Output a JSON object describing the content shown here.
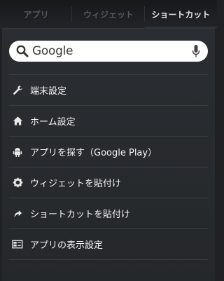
{
  "tabs": [
    {
      "label": "アプリ"
    },
    {
      "label": "ウィジェット"
    },
    {
      "label": "ショートカット"
    }
  ],
  "active_tab": "ショートカット",
  "search": {
    "value": "Google",
    "icon": "search-icon",
    "voice_icon": "microphone-icon"
  },
  "menu": {
    "items": [
      {
        "label": "端末設定",
        "icon": "wrench-icon"
      },
      {
        "label": "ホーム設定",
        "icon": "home-icon"
      },
      {
        "label": "アプリを探す（Google Play）",
        "icon": "android-icon"
      },
      {
        "label": "ウィジェットを貼付け",
        "icon": "gear-icon"
      },
      {
        "label": "ショートカットを貼付け",
        "icon": "shortcut-arrow-icon"
      },
      {
        "label": "アプリの表示設定",
        "icon": "app-display-icon"
      }
    ]
  }
}
